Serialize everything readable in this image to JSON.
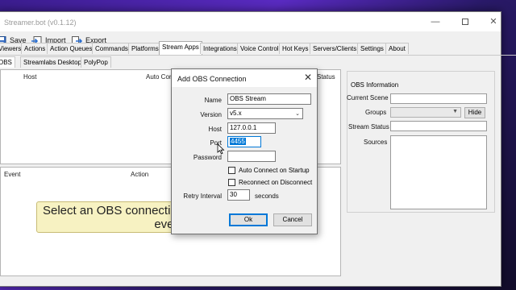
{
  "app": {
    "title": "Streamer.bot (v0.1.12)"
  },
  "toolbar": {
    "save": "Save",
    "import": "Import",
    "export": "Export"
  },
  "main_tabs": [
    "Viewers",
    "Actions",
    "Action Queues",
    "Commands",
    "Platforms",
    "Stream Apps",
    "Integrations",
    "Voice Control",
    "Hot Keys",
    "Servers/Clients",
    "Settings",
    "About"
  ],
  "main_tabs_active": "Stream Apps",
  "sub_tabs": [
    "OBS",
    "Streamlabs Desktop",
    "PolyPop"
  ],
  "sub_tabs_active": "OBS",
  "connections_table": {
    "columns": [
      "Host",
      "Auto Conn",
      "Status"
    ]
  },
  "events_table": {
    "columns": [
      "Event",
      "Action"
    ]
  },
  "notice": {
    "line1": "Select an OBS connection",
    "line2": "events!"
  },
  "obs_info": {
    "legend": "OBS Information",
    "current_scene": "Current Scene",
    "groups": "Groups",
    "hide_button": "Hide",
    "stream_status": "Stream Status",
    "sources": "Sources"
  },
  "dialog": {
    "title": "Add OBS Connection",
    "name_label": "Name",
    "name_value": "OBS Stream",
    "version_label": "Version",
    "version_value": "v5.x",
    "host_label": "Host",
    "host_value": "127.0.0.1",
    "port_label": "Port",
    "port_value": "4455",
    "password_label": "Password",
    "password_value": "",
    "auto_connect": "Auto Connect on Startup",
    "reconnect": "Reconnect on Disconnect",
    "retry_label": "Retry Interval",
    "retry_value": "30",
    "retry_unit": "seconds",
    "ok": "Ok",
    "cancel": "Cancel"
  },
  "colors": {
    "accent": "#0078d7",
    "notice_bg": "#f7f2c2",
    "desktop": "#3b1d8f"
  },
  "icons": [
    "save-icon",
    "import-icon",
    "export-icon",
    "close-icon",
    "minimize-icon",
    "maximize-icon",
    "dropdown-arrow-icon",
    "mouse-cursor-icon"
  ]
}
